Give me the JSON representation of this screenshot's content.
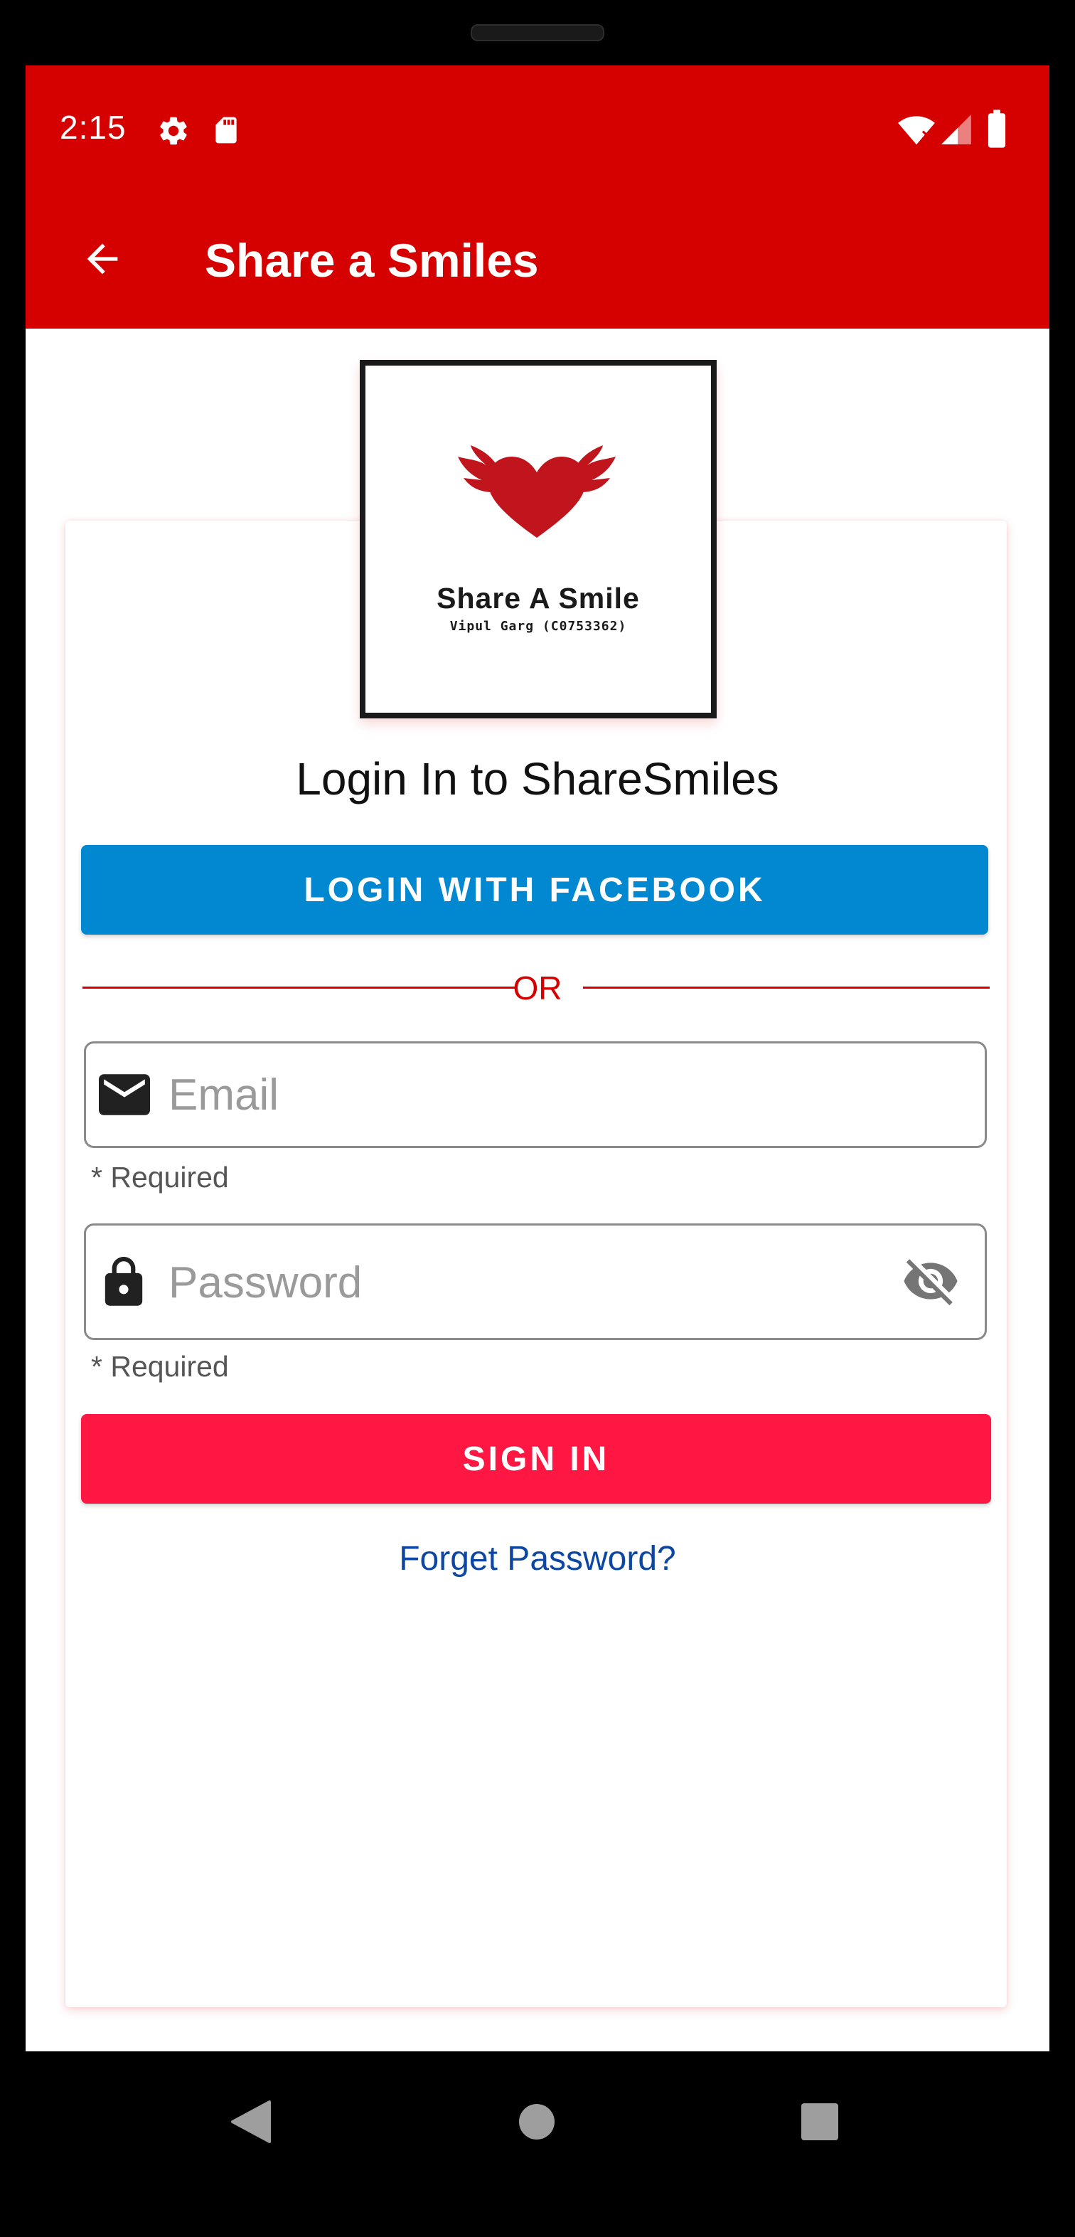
{
  "status_bar": {
    "time": "2:15",
    "left_icons": [
      "gear-icon",
      "sd-card-icon"
    ],
    "right_icons": [
      "wifi-off-icon",
      "signal-icon",
      "battery-icon"
    ]
  },
  "app_bar": {
    "title": "Share a Smiles",
    "back_icon": "arrow-back-icon"
  },
  "logo": {
    "title": "Share A Smile",
    "subtitle": "Vipul Garg (C0753362)",
    "icon": "winged-heart-icon"
  },
  "heading": "Login In to ShareSmiles",
  "facebook_button": "LOGIN WITH FACEBOOK",
  "divider_label": "OR",
  "email": {
    "placeholder": "Email",
    "value": "",
    "helper": "* Required",
    "icon": "mail-icon"
  },
  "password": {
    "placeholder": "Password",
    "value": "",
    "helper": "* Required",
    "icon": "lock-icon",
    "toggle_icon": "visibility-off-icon"
  },
  "signin_button": "SIGN IN",
  "forgot_link": "Forget Password?",
  "navigation": {
    "buttons": [
      "back-nav-icon",
      "home-nav-icon",
      "recents-nav-icon"
    ]
  },
  "colors": {
    "primary": "#d50000",
    "facebook": "#0288d1",
    "signin": "#ff1744",
    "link": "#0d47a1"
  }
}
